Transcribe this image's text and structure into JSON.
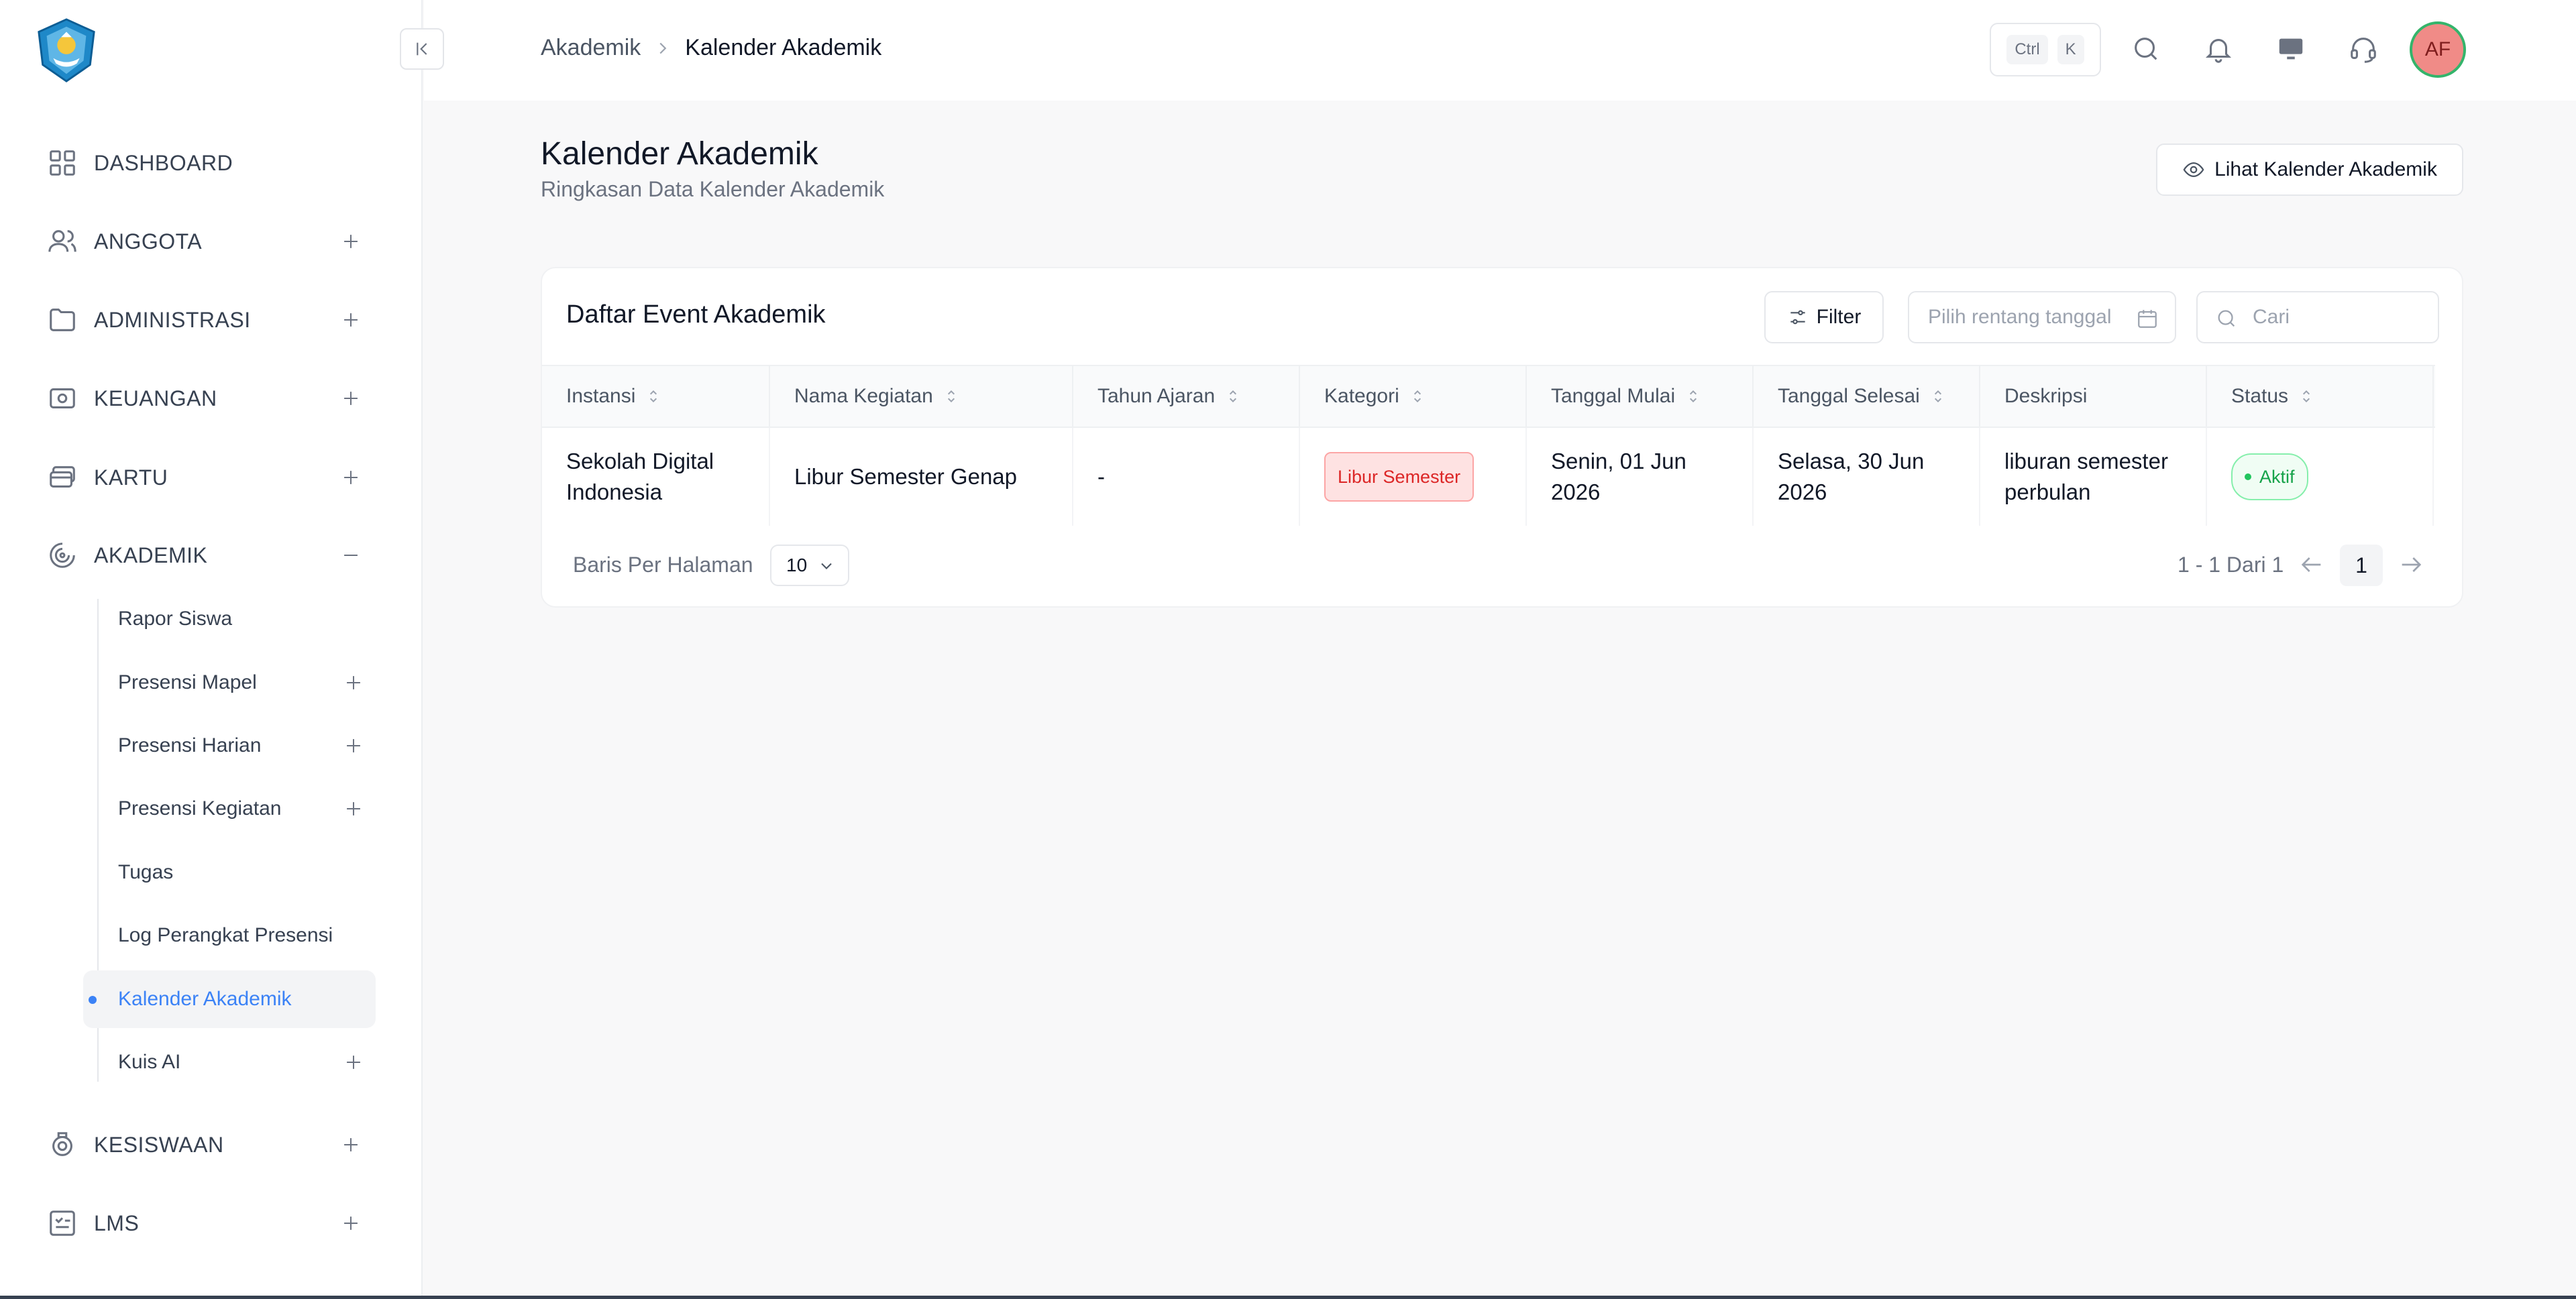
{
  "sidebar": {
    "items": [
      {
        "label": "DASHBOARD",
        "icon": "grid-icon"
      },
      {
        "label": "ANGGOTA",
        "icon": "users-icon"
      },
      {
        "label": "ADMINISTRASI",
        "icon": "folder-icon"
      },
      {
        "label": "KEUANGAN",
        "icon": "wallet-icon"
      },
      {
        "label": "KARTU",
        "icon": "card-icon"
      },
      {
        "label": "AKADEMIK",
        "icon": "academic-icon"
      },
      {
        "label": "KESISWAAN",
        "icon": "badge-icon"
      },
      {
        "label": "LMS",
        "icon": "list-icon"
      }
    ],
    "akademik_sub": [
      {
        "label": "Rapor Siswa"
      },
      {
        "label": "Presensi Mapel"
      },
      {
        "label": "Presensi Harian"
      },
      {
        "label": "Presensi Kegiatan"
      },
      {
        "label": "Tugas"
      },
      {
        "label": "Log Perangkat Presensi"
      },
      {
        "label": "Kalender Akademik"
      },
      {
        "label": "Kuis AI"
      }
    ]
  },
  "topbar": {
    "breadcrumb": [
      "Akademik",
      "Kalender Akademik"
    ],
    "kbd": [
      "Ctrl",
      "K"
    ],
    "avatar": "AF"
  },
  "page": {
    "title": "Kalender Akademik",
    "subtitle": "Ringkasan Data Kalender Akademik",
    "view_button": "Lihat Kalender Akademik"
  },
  "card": {
    "title": "Daftar Event Akademik",
    "filter_label": "Filter",
    "date_placeholder": "Pilih rentang tanggal",
    "search_placeholder": "Cari",
    "columns": [
      "Instansi",
      "Nama Kegiatan",
      "Tahun Ajaran",
      "Kategori",
      "Tanggal Mulai",
      "Tanggal Selesai",
      "Deskripsi",
      "Status"
    ],
    "rows": [
      {
        "instansi": "Sekolah Digital Indonesia",
        "nama": "Libur Semester Genap",
        "tahun": "-",
        "kategori": "Libur Semester",
        "mulai": "Senin, 01 Jun 2026",
        "selesai": "Selasa, 30 Jun 2026",
        "deskripsi": "liburan semester perbulan",
        "status": "Aktif"
      }
    ],
    "rows_per_page_label": "Baris Per Halaman",
    "rows_per_page": "10",
    "range": "1 - 1 Dari 1",
    "current_page": "1"
  },
  "colors": {
    "accent": "#3b82f6",
    "danger": "#dc2626",
    "success": "#16a34a",
    "avatar_bg": "#f08b87"
  }
}
